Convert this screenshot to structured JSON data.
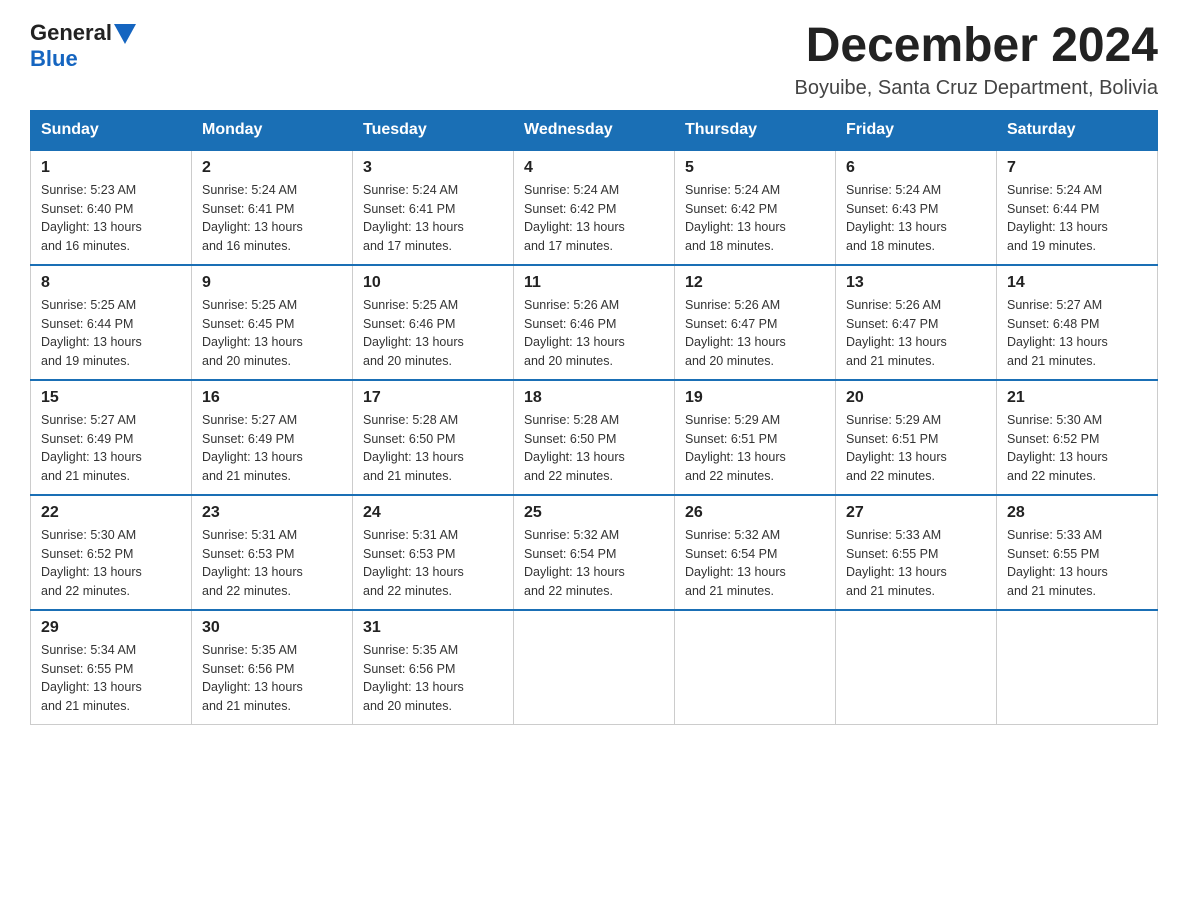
{
  "header": {
    "logo_general": "General",
    "logo_blue": "Blue",
    "month_title": "December 2024",
    "location": "Boyuibe, Santa Cruz Department, Bolivia"
  },
  "weekdays": [
    "Sunday",
    "Monday",
    "Tuesday",
    "Wednesday",
    "Thursday",
    "Friday",
    "Saturday"
  ],
  "weeks": [
    [
      {
        "day": "1",
        "sunrise": "5:23 AM",
        "sunset": "6:40 PM",
        "daylight": "13 hours and 16 minutes."
      },
      {
        "day": "2",
        "sunrise": "5:24 AM",
        "sunset": "6:41 PM",
        "daylight": "13 hours and 16 minutes."
      },
      {
        "day": "3",
        "sunrise": "5:24 AM",
        "sunset": "6:41 PM",
        "daylight": "13 hours and 17 minutes."
      },
      {
        "day": "4",
        "sunrise": "5:24 AM",
        "sunset": "6:42 PM",
        "daylight": "13 hours and 17 minutes."
      },
      {
        "day": "5",
        "sunrise": "5:24 AM",
        "sunset": "6:42 PM",
        "daylight": "13 hours and 18 minutes."
      },
      {
        "day": "6",
        "sunrise": "5:24 AM",
        "sunset": "6:43 PM",
        "daylight": "13 hours and 18 minutes."
      },
      {
        "day": "7",
        "sunrise": "5:24 AM",
        "sunset": "6:44 PM",
        "daylight": "13 hours and 19 minutes."
      }
    ],
    [
      {
        "day": "8",
        "sunrise": "5:25 AM",
        "sunset": "6:44 PM",
        "daylight": "13 hours and 19 minutes."
      },
      {
        "day": "9",
        "sunrise": "5:25 AM",
        "sunset": "6:45 PM",
        "daylight": "13 hours and 20 minutes."
      },
      {
        "day": "10",
        "sunrise": "5:25 AM",
        "sunset": "6:46 PM",
        "daylight": "13 hours and 20 minutes."
      },
      {
        "day": "11",
        "sunrise": "5:26 AM",
        "sunset": "6:46 PM",
        "daylight": "13 hours and 20 minutes."
      },
      {
        "day": "12",
        "sunrise": "5:26 AM",
        "sunset": "6:47 PM",
        "daylight": "13 hours and 20 minutes."
      },
      {
        "day": "13",
        "sunrise": "5:26 AM",
        "sunset": "6:47 PM",
        "daylight": "13 hours and 21 minutes."
      },
      {
        "day": "14",
        "sunrise": "5:27 AM",
        "sunset": "6:48 PM",
        "daylight": "13 hours and 21 minutes."
      }
    ],
    [
      {
        "day": "15",
        "sunrise": "5:27 AM",
        "sunset": "6:49 PM",
        "daylight": "13 hours and 21 minutes."
      },
      {
        "day": "16",
        "sunrise": "5:27 AM",
        "sunset": "6:49 PM",
        "daylight": "13 hours and 21 minutes."
      },
      {
        "day": "17",
        "sunrise": "5:28 AM",
        "sunset": "6:50 PM",
        "daylight": "13 hours and 21 minutes."
      },
      {
        "day": "18",
        "sunrise": "5:28 AM",
        "sunset": "6:50 PM",
        "daylight": "13 hours and 22 minutes."
      },
      {
        "day": "19",
        "sunrise": "5:29 AM",
        "sunset": "6:51 PM",
        "daylight": "13 hours and 22 minutes."
      },
      {
        "day": "20",
        "sunrise": "5:29 AM",
        "sunset": "6:51 PM",
        "daylight": "13 hours and 22 minutes."
      },
      {
        "day": "21",
        "sunrise": "5:30 AM",
        "sunset": "6:52 PM",
        "daylight": "13 hours and 22 minutes."
      }
    ],
    [
      {
        "day": "22",
        "sunrise": "5:30 AM",
        "sunset": "6:52 PM",
        "daylight": "13 hours and 22 minutes."
      },
      {
        "day": "23",
        "sunrise": "5:31 AM",
        "sunset": "6:53 PM",
        "daylight": "13 hours and 22 minutes."
      },
      {
        "day": "24",
        "sunrise": "5:31 AM",
        "sunset": "6:53 PM",
        "daylight": "13 hours and 22 minutes."
      },
      {
        "day": "25",
        "sunrise": "5:32 AM",
        "sunset": "6:54 PM",
        "daylight": "13 hours and 22 minutes."
      },
      {
        "day": "26",
        "sunrise": "5:32 AM",
        "sunset": "6:54 PM",
        "daylight": "13 hours and 21 minutes."
      },
      {
        "day": "27",
        "sunrise": "5:33 AM",
        "sunset": "6:55 PM",
        "daylight": "13 hours and 21 minutes."
      },
      {
        "day": "28",
        "sunrise": "5:33 AM",
        "sunset": "6:55 PM",
        "daylight": "13 hours and 21 minutes."
      }
    ],
    [
      {
        "day": "29",
        "sunrise": "5:34 AM",
        "sunset": "6:55 PM",
        "daylight": "13 hours and 21 minutes."
      },
      {
        "day": "30",
        "sunrise": "5:35 AM",
        "sunset": "6:56 PM",
        "daylight": "13 hours and 21 minutes."
      },
      {
        "day": "31",
        "sunrise": "5:35 AM",
        "sunset": "6:56 PM",
        "daylight": "13 hours and 20 minutes."
      },
      null,
      null,
      null,
      null
    ]
  ]
}
